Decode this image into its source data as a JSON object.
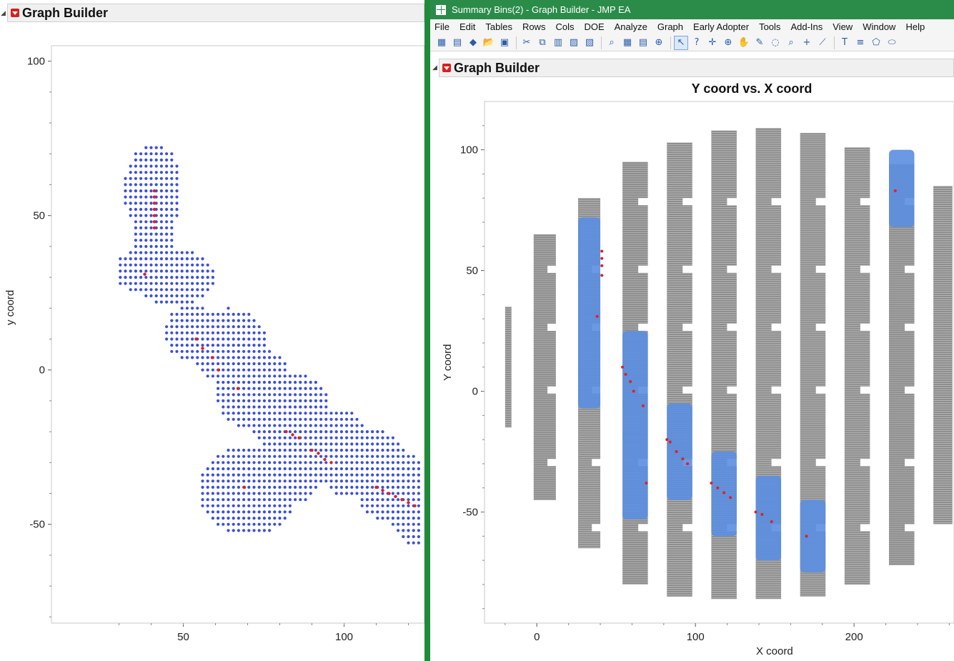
{
  "left_panel": {
    "header_title": "Graph Builder",
    "chart": {
      "ylabel": "y coord",
      "x_ticks": [
        "50",
        "100"
      ],
      "y_ticks": [
        "100",
        "50",
        "0",
        "-50"
      ]
    }
  },
  "right_window": {
    "window_title": "Summary Bins(2) - Graph Builder - JMP EA",
    "menu": [
      "File",
      "Edit",
      "Tables",
      "Rows",
      "Cols",
      "DOE",
      "Analyze",
      "Graph",
      "Early Adopter",
      "Tools",
      "Add-Ins",
      "View",
      "Window",
      "Help"
    ],
    "toolbar_icons": [
      "new-table-icon",
      "new-script-icon",
      "python-icon",
      "open-icon",
      "save-icon",
      "cut-icon",
      "copy-icon",
      "paste-icon",
      "journal-icon",
      "format-icon",
      "search-icon",
      "data-table-icon",
      "report-icon",
      "add-icon",
      "arrow-tool-icon",
      "help-tool-icon",
      "crosshair-tool-icon",
      "target-tool-icon",
      "hand-tool-icon",
      "brush-tool-icon",
      "lasso-tool-icon",
      "magnifier-tool-icon",
      "plus-tool-icon",
      "line-tool-icon",
      "text-tool-icon",
      "list-tool-icon",
      "polygon-tool-icon",
      "ellipse-tool-icon"
    ],
    "header_title": "Graph Builder",
    "chart": {
      "title": "Y coord vs. X coord",
      "xlabel": "X coord",
      "ylabel": "Y coord",
      "x_ticks": [
        "0",
        "100",
        "200"
      ],
      "y_ticks": [
        "100",
        "50",
        "0",
        "-50"
      ]
    }
  },
  "colors": {
    "blue_points": "#3b4fd8",
    "red_points": "#e02020",
    "gray_points": "#7a7a7a",
    "light_blue_regions": "#5b8ee0",
    "accent_green": "#2b8c4a"
  },
  "chart_data": [
    {
      "type": "scatter",
      "title": "",
      "xlabel": "",
      "ylabel": "y coord",
      "xlim": [
        9,
        125
      ],
      "ylim": [
        -82,
        105
      ],
      "x_ticks": [
        50,
        100
      ],
      "y_ticks": [
        100,
        50,
        0,
        -50
      ],
      "series": [
        {
          "color": "#3b4fd8",
          "description_regions": [
            [
              34,
              39,
              43,
              72
            ],
            [
              39,
              31,
              47,
              18
            ],
            [
              48,
              26,
              57,
              5
            ],
            [
              56,
              22,
              74,
              -9
            ],
            [
              74,
              5,
              96,
              -26
            ],
            [
              93,
              -12,
              125,
              -60
            ],
            [
              55,
              -22,
              88,
              -54
            ]
          ]
        },
        {
          "color": "#e02020",
          "points": [
            [
              41,
              58
            ],
            [
              41,
              56
            ],
            [
              41,
              54
            ],
            [
              41,
              52
            ],
            [
              41,
              50
            ],
            [
              41,
              48
            ],
            [
              41,
              46
            ],
            [
              38,
              31
            ],
            [
              54,
              10
            ],
            [
              56,
              7
            ],
            [
              59,
              4
            ],
            [
              61,
              0
            ],
            [
              67,
              -6
            ],
            [
              82,
              -20
            ],
            [
              84,
              -21
            ],
            [
              86,
              -22
            ],
            [
              90,
              -26
            ],
            [
              92,
              -27
            ],
            [
              94,
              -29
            ],
            [
              96,
              -30
            ],
            [
              69,
              -38
            ],
            [
              110,
              -38
            ],
            [
              112,
              -39
            ],
            [
              114,
              -40
            ],
            [
              116,
              -41
            ],
            [
              118,
              -42
            ],
            [
              120,
              -43
            ],
            [
              122,
              -44
            ]
          ]
        }
      ]
    },
    {
      "type": "scatter",
      "title": "Y coord vs. X coord",
      "xlabel": "X coord",
      "ylabel": "Y coord",
      "xlim": [
        -33,
        263
      ],
      "ylim": [
        -96,
        120
      ],
      "x_ticks": [
        0,
        100,
        200
      ],
      "y_ticks": [
        100,
        50,
        0,
        -50
      ],
      "columns": [
        {
          "x": [
            -20,
            -16
          ],
          "y": [
            -15,
            35
          ]
        },
        {
          "x": [
            -2,
            12
          ],
          "y": [
            -45,
            65
          ]
        },
        {
          "x": [
            26,
            40
          ],
          "y": [
            -65,
            80
          ]
        },
        {
          "x": [
            54,
            70
          ],
          "y": [
            -80,
            95
          ]
        },
        {
          "x": [
            82,
            98
          ],
          "y": [
            -85,
            103
          ]
        },
        {
          "x": [
            110,
            126
          ],
          "y": [
            -86,
            108
          ]
        },
        {
          "x": [
            138,
            154
          ],
          "y": [
            -86,
            109
          ]
        },
        {
          "x": [
            166,
            182
          ],
          "y": [
            -85,
            107
          ]
        },
        {
          "x": [
            194,
            210
          ],
          "y": [
            -80,
            101
          ]
        },
        {
          "x": [
            222,
            238
          ],
          "y": [
            -72,
            94
          ]
        },
        {
          "x": [
            250,
            262
          ],
          "y": [
            -55,
            85
          ]
        }
      ],
      "blue_regions": [
        {
          "x": [
            26,
            40
          ],
          "y": [
            -7,
            72
          ]
        },
        {
          "x": [
            54,
            70
          ],
          "y": [
            -53,
            25
          ]
        },
        {
          "x": [
            82,
            98
          ],
          "y": [
            -45,
            -5
          ]
        },
        {
          "x": [
            110,
            126
          ],
          "y": [
            -60,
            -25
          ]
        },
        {
          "x": [
            138,
            154
          ],
          "y": [
            -70,
            -35
          ]
        },
        {
          "x": [
            166,
            182
          ],
          "y": [
            -75,
            -45
          ]
        },
        {
          "x": [
            222,
            238
          ],
          "y": [
            68,
            100
          ]
        }
      ],
      "red_points": [
        [
          41,
          58
        ],
        [
          41,
          55
        ],
        [
          41,
          52
        ],
        [
          41,
          48
        ],
        [
          38,
          31
        ],
        [
          54,
          10
        ],
        [
          56,
          7
        ],
        [
          59,
          4
        ],
        [
          61,
          0
        ],
        [
          67,
          -6
        ],
        [
          82,
          -20
        ],
        [
          84,
          -21
        ],
        [
          88,
          -25
        ],
        [
          92,
          -28
        ],
        [
          95,
          -30
        ],
        [
          69,
          -38
        ],
        [
          110,
          -38
        ],
        [
          114,
          -40
        ],
        [
          118,
          -42
        ],
        [
          122,
          -44
        ],
        [
          138,
          -50
        ],
        [
          142,
          -51
        ],
        [
          148,
          -54
        ],
        [
          170,
          -60
        ],
        [
          226,
          83
        ]
      ]
    }
  ]
}
